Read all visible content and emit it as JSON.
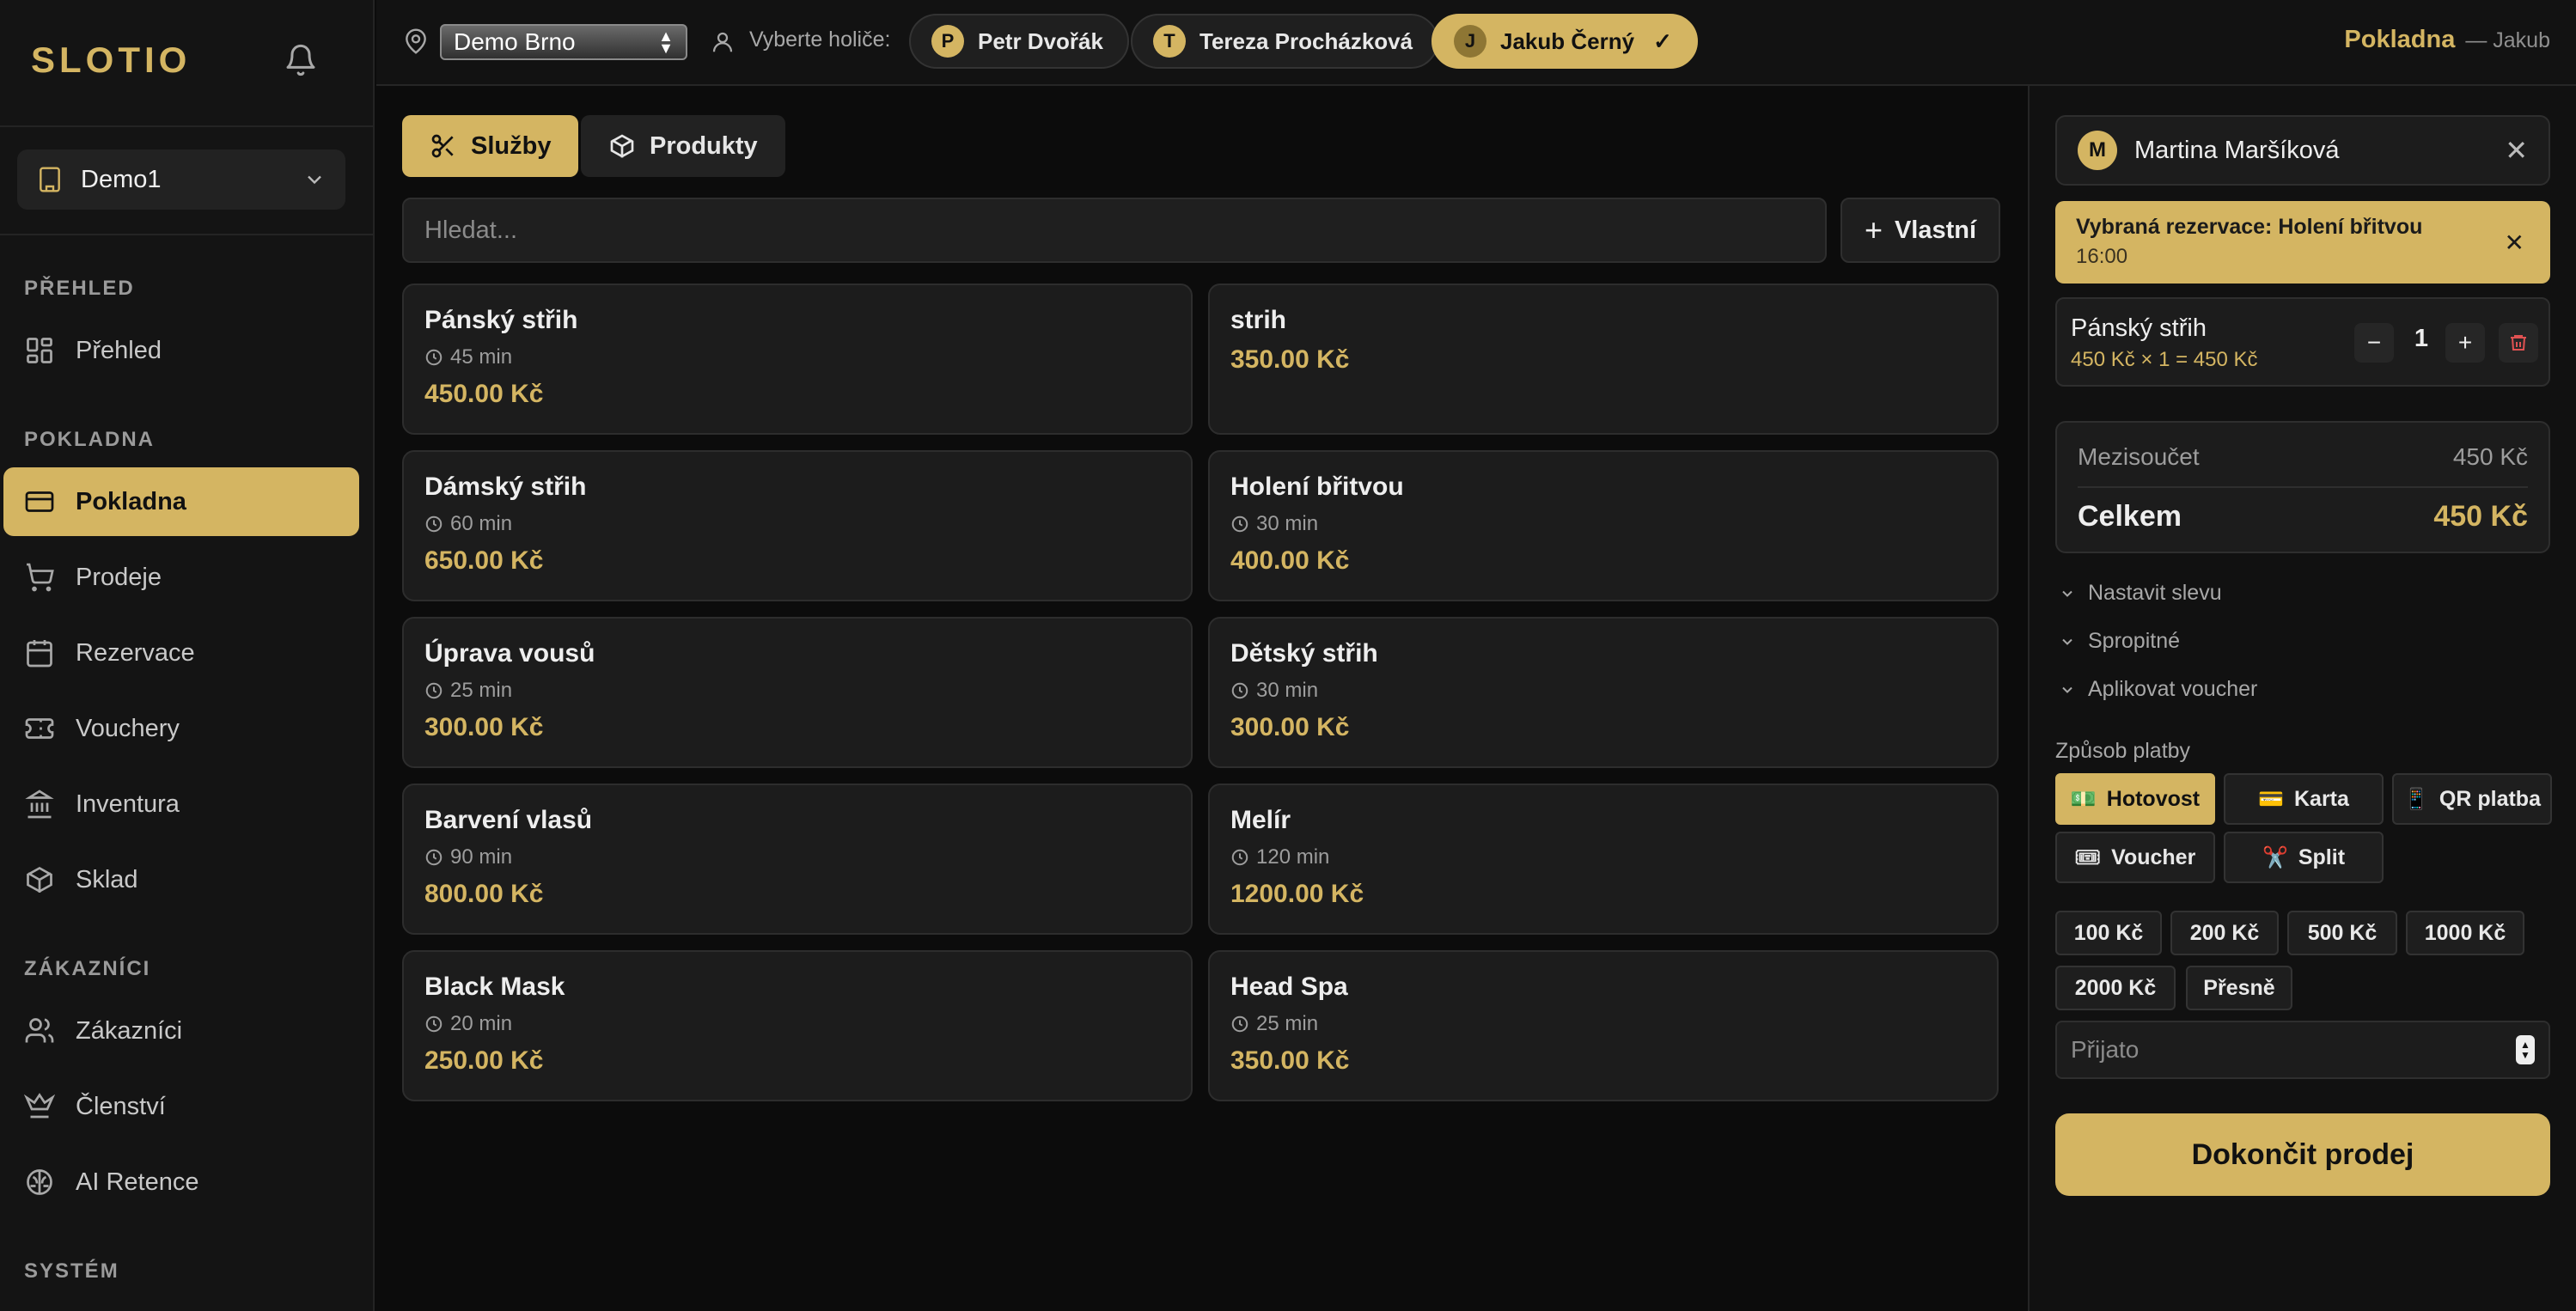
{
  "sidebar": {
    "brand": "SLOTIO",
    "branch": "Demo1",
    "sections": {
      "overview": "PŘEHLED",
      "pos": "POKLADNA",
      "customers": "ZÁKAZNÍCI",
      "system": "SYSTÉM"
    },
    "items": {
      "overview": "Přehled",
      "pos": "Pokladna",
      "sales": "Prodeje",
      "reservations": "Rezervace",
      "vouchers": "Vouchery",
      "inventory": "Inventura",
      "stock": "Sklad",
      "customers": "Zákazníci",
      "membership": "Členství",
      "ai_retention": "AI Retence"
    }
  },
  "topbar": {
    "location": "Demo Brno",
    "barber_label": "Vyberte holiče:",
    "barbers": [
      {
        "initial": "P",
        "name": "Petr Dvořák",
        "selected": false
      },
      {
        "initial": "T",
        "name": "Tereza Procházková",
        "selected": false
      },
      {
        "initial": "J",
        "name": "Jakub Černý",
        "selected": true
      }
    ],
    "check": "✓",
    "page": "Pokladna",
    "user": "— Jakub"
  },
  "main": {
    "tabs": {
      "services": "Služby",
      "products": "Produkty"
    },
    "search_placeholder": "Hledat...",
    "custom_button": "Vlastní",
    "services": [
      {
        "name": "Pánský střih",
        "duration": "45 min",
        "price": "450.00 Kč"
      },
      {
        "name": "strih",
        "duration": "",
        "price": "350.00 Kč"
      },
      {
        "name": "Dámský střih",
        "duration": "60 min",
        "price": "650.00 Kč"
      },
      {
        "name": "Holení břitvou",
        "duration": "30 min",
        "price": "400.00 Kč"
      },
      {
        "name": "Úprava vousů",
        "duration": "25 min",
        "price": "300.00 Kč"
      },
      {
        "name": "Dětský střih",
        "duration": "30 min",
        "price": "300.00 Kč"
      },
      {
        "name": "Barvení vlasů",
        "duration": "90 min",
        "price": "800.00 Kč"
      },
      {
        "name": "Melír",
        "duration": "120 min",
        "price": "1200.00 Kč"
      },
      {
        "name": "Black Mask",
        "duration": "20 min",
        "price": "250.00 Kč"
      },
      {
        "name": "Head Spa",
        "duration": "25 min",
        "price": "350.00 Kč"
      }
    ]
  },
  "cart": {
    "customer": {
      "initial": "M",
      "name": "Martina Maršíková"
    },
    "reservation": {
      "title": "Vybraná rezervace: Holení břitvou",
      "time": "16:00"
    },
    "items": [
      {
        "name": "Pánský střih",
        "calc": "450 Kč × 1 = 450 Kč",
        "qty": "1"
      }
    ],
    "subtotal_label": "Mezisoučet",
    "subtotal": "450 Kč",
    "total_label": "Celkem",
    "total": "450 Kč",
    "collapsibles": {
      "discount": "Nastavit slevu",
      "tip": "Spropitné",
      "voucher": "Aplikovat voucher"
    },
    "payment_label": "Způsob platby",
    "payment_methods": [
      {
        "icon": "💵",
        "label": "Hotovost",
        "selected": true
      },
      {
        "icon": "💳",
        "label": "Karta",
        "selected": false
      },
      {
        "icon": "📱",
        "label": "QR platba",
        "selected": false
      },
      {
        "icon": "🎟",
        "label": "Voucher",
        "selected": false
      },
      {
        "icon": "✂️",
        "label": "Split",
        "selected": false
      }
    ],
    "quick_amounts": [
      "100 Kč",
      "200 Kč",
      "500 Kč",
      "1000 Kč",
      "2000 Kč",
      "Přesně"
    ],
    "received_placeholder": "Přijato",
    "finish": "Dokončit prodej"
  },
  "colors": {
    "accent": "#d4b562",
    "background": "#0c0c0c",
    "panel": "#1c1c1c",
    "danger": "#e05252"
  }
}
